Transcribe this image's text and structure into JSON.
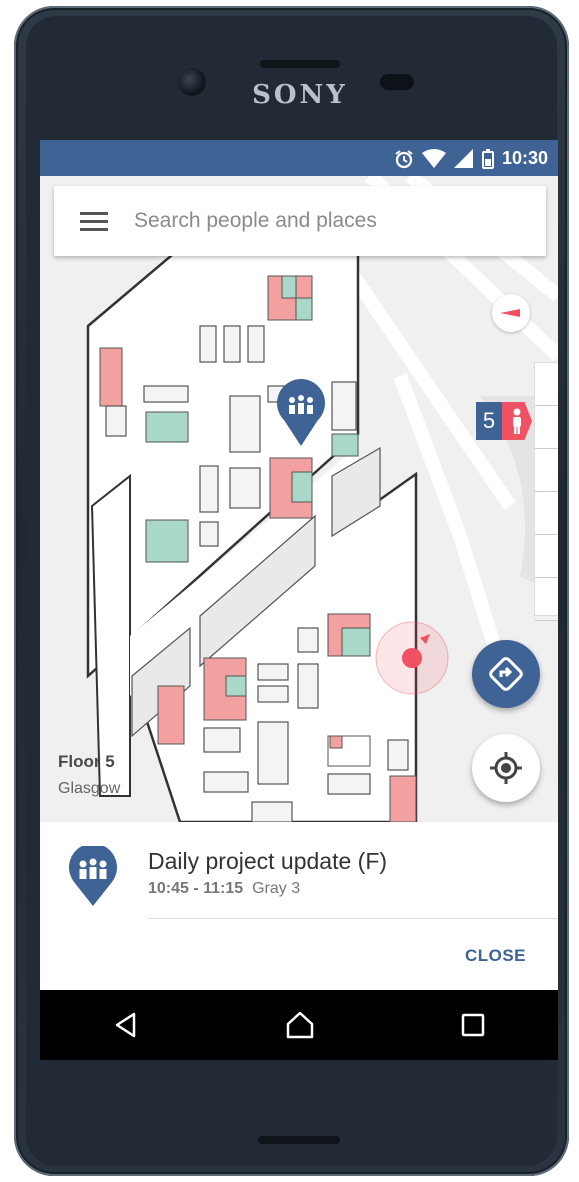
{
  "device": {
    "brand": "SONY"
  },
  "status_bar": {
    "time": "10:30",
    "icons": [
      "alarm-icon",
      "wifi-icon",
      "signal-icon",
      "battery-icon"
    ]
  },
  "search": {
    "placeholder": "Search people and places"
  },
  "map": {
    "floor_badge": "5",
    "floor_label": "Floor 5",
    "building_label": "Glasgow"
  },
  "event_sheet": {
    "title": "Daily project update (F)",
    "time": "10:45 - 11:15",
    "room": "Gray 3",
    "close_label": "CLOSE"
  },
  "nav": {
    "buttons": [
      "back-icon",
      "home-icon",
      "recents-icon"
    ]
  },
  "colors": {
    "primary": "#3f6394",
    "accent_red": "#f05163",
    "room_red": "#f2a0a0",
    "room_green": "#a9d8c8"
  }
}
